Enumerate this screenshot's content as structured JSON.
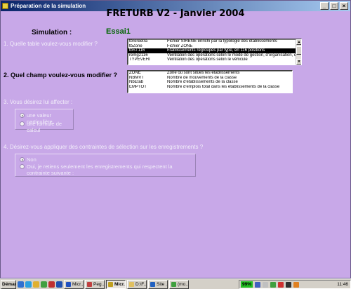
{
  "window": {
    "title": "Préparation de la simulation",
    "controls": {
      "minimize": "_",
      "maximize": "□",
      "close": "×"
    }
  },
  "header": {
    "title": "FRETURB V2 - Janvier 2004",
    "simulation_label": "Simulation :",
    "simulation_value": "Essai1"
  },
  "q1": {
    "label": "1. Quelle table voulez-vous modifier ?",
    "rows": [
      {
        "name": "tbSireetra",
        "desc": "Fichier SIRENE enrichi par la typologie des établissements"
      },
      {
        "name": "tbZone",
        "desc": "Fichier ZONE"
      },
      {
        "name": "tbST116",
        "desc": "Etablissements regroupés par type, en 116 positions",
        "selected": true
      },
      {
        "name": "remg2116",
        "desc": "Ventilation des opérations selon le mode de gestion, d'organisation, etc."
      },
      {
        "name": "TYPEVEHI",
        "desc": "Ventilation des opérations selon le véhicule"
      }
    ]
  },
  "q2": {
    "label": "2. Quel champ voulez-vous modifier ?",
    "rows": [
      {
        "name": "ZONE",
        "desc": "Zone où sont situés les établissements"
      },
      {
        "name": "NBMVT",
        "desc": "Nombre de mouvements de la classe"
      },
      {
        "name": "NbEtab",
        "desc": "Nombre d'établissements de la classe"
      },
      {
        "name": "EMPTOT",
        "desc": "Nombre d'emplois total dans les établissements de la classe"
      }
    ]
  },
  "q3": {
    "label": "3. Vous désirez lui affecter :",
    "option1": "une valeur particulière",
    "option2": "une formule de calcul"
  },
  "q4": {
    "label": "4. Désirez-vous appliquer des contraintes de sélection sur les enregistrements ?",
    "option1": "Non",
    "option2": "Oui, je retiens seulement les enregistrements qui respectent la contrainte suivante :"
  },
  "taskbar": {
    "start": "Démarrer",
    "tasks": [
      {
        "label": "Micr...",
        "color": "#2050c0"
      },
      {
        "label": "Peg...",
        "color": "#c04040"
      },
      {
        "label": "Micr...",
        "color": "#c0a020",
        "pressed": true
      },
      {
        "label": "D:\\F...",
        "color": "#e0c060"
      },
      {
        "label": "Site ...",
        "color": "#2060c0"
      },
      {
        "label": "(mo...",
        "color": "#40a040"
      }
    ],
    "battery": "99%",
    "clock": "11:46"
  },
  "colors": {
    "window_bg": "#c8a8e8",
    "title_gradient_start": "#0a246a",
    "simulation_value": "#006400"
  }
}
